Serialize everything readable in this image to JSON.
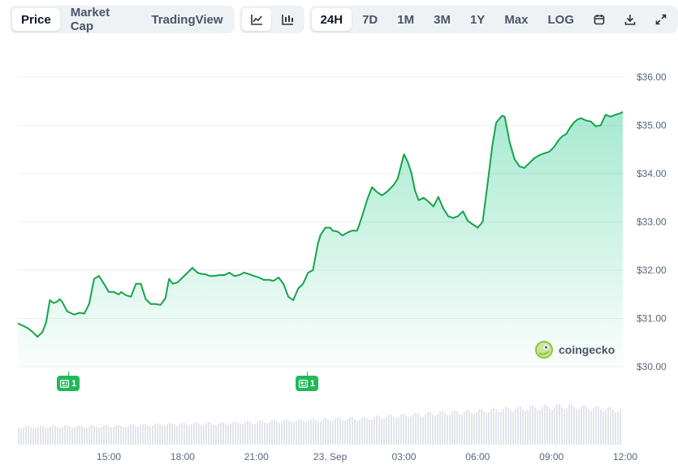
{
  "toolbar": {
    "chart_tabs": [
      {
        "label": "Price",
        "active": true
      },
      {
        "label": "Market Cap",
        "active": false
      },
      {
        "label": "TradingView",
        "active": false
      }
    ],
    "chart_style_icons": [
      {
        "icon": "line-chart-icon",
        "active": true
      },
      {
        "icon": "candlestick-icon",
        "active": false
      }
    ],
    "ranges": [
      {
        "label": "24H",
        "active": true
      },
      {
        "label": "7D",
        "active": false
      },
      {
        "label": "1M",
        "active": false
      },
      {
        "label": "3M",
        "active": false
      },
      {
        "label": "1Y",
        "active": false
      },
      {
        "label": "Max",
        "active": false
      },
      {
        "label": "LOG",
        "active": false
      }
    ],
    "action_icons": [
      "calendar-icon",
      "download-icon",
      "expand-icon"
    ]
  },
  "brand": {
    "name": "coingecko",
    "icon": "gecko-logo-icon"
  },
  "events": [
    {
      "count": "1",
      "x_hour": 13.35,
      "icon": "news-icon"
    },
    {
      "count": "1",
      "x_hour": 23.05,
      "icon": "news-icon"
    }
  ],
  "colors": {
    "line": "#16a34a",
    "area": "#16c784",
    "volume": "#e2e5ea",
    "badge": "#22b859"
  },
  "chart_data": {
    "type": "area",
    "title": "",
    "xlabel": "",
    "ylabel": "",
    "x_range_hours": [
      11.3,
      35.9
    ],
    "ylim": [
      29.9,
      36.2
    ],
    "y_ticks": [
      30,
      31,
      32,
      33,
      34,
      35,
      36
    ],
    "y_tick_labels": [
      "$30.00",
      "$31.00",
      "$32.00",
      "$33.00",
      "$34.00",
      "$35.00",
      "$36.00"
    ],
    "x_ticks": [
      {
        "hour": 15,
        "label": "15:00"
      },
      {
        "hour": 18,
        "label": "18:00"
      },
      {
        "hour": 21,
        "label": "21:00"
      },
      {
        "hour": 24,
        "label": "23. Sep"
      },
      {
        "hour": 27,
        "label": "03:00"
      },
      {
        "hour": 30,
        "label": "06:00"
      },
      {
        "hour": 33,
        "label": "09:00"
      },
      {
        "hour": 36,
        "label": "12:00"
      }
    ],
    "grid": true,
    "series": [
      {
        "x": [
          11.3,
          11.5,
          11.7,
          11.9,
          12.1,
          12.3,
          12.45,
          12.6,
          12.75,
          12.9,
          13.0,
          13.1,
          13.3,
          13.5,
          13.6,
          13.8,
          14.0,
          14.2,
          14.4,
          14.6,
          14.8,
          15.0,
          15.2,
          15.4,
          15.5,
          15.7,
          15.9,
          16.1,
          16.3,
          16.5,
          16.7,
          16.9,
          17.1,
          17.3,
          17.45,
          17.6,
          17.8,
          18.0,
          18.2,
          18.4,
          18.6,
          18.8,
          18.9,
          19.1,
          19.3,
          19.5,
          19.7,
          19.9,
          20.1,
          20.3,
          20.5,
          20.7,
          20.9,
          21.1,
          21.3,
          21.5,
          21.7,
          21.9,
          22.1,
          22.3,
          22.5,
          22.7,
          22.9,
          23.1,
          23.3,
          23.5,
          23.6,
          23.8,
          23.9,
          24.0,
          24.1,
          24.3,
          24.5,
          24.7,
          24.9,
          25.1,
          25.3,
          25.5,
          25.7,
          25.9,
          26.1,
          26.3,
          26.5,
          26.6,
          26.75,
          26.9,
          27.0,
          27.15,
          27.3,
          27.45,
          27.6,
          27.8,
          28.0,
          28.2,
          28.4,
          28.6,
          28.8,
          29.0,
          29.2,
          29.4,
          29.6,
          29.8,
          30.0,
          30.2,
          30.4,
          30.6,
          30.75,
          30.9,
          31.0,
          31.1,
          31.3,
          31.5,
          31.7,
          31.9,
          32.1,
          32.3,
          32.5,
          32.7,
          32.9,
          33.1,
          33.3,
          33.45,
          33.6,
          33.75,
          33.9,
          34.05,
          34.2,
          34.4,
          34.6,
          34.8,
          35.0,
          35.2,
          35.4,
          35.6,
          35.8,
          35.9
        ],
        "y": [
          30.9,
          30.85,
          30.8,
          30.72,
          30.62,
          30.72,
          30.92,
          31.38,
          31.32,
          31.35,
          31.4,
          31.35,
          31.15,
          31.1,
          31.08,
          31.12,
          31.1,
          31.3,
          31.82,
          31.88,
          31.72,
          31.55,
          31.55,
          31.5,
          31.55,
          31.48,
          31.45,
          31.72,
          31.72,
          31.4,
          31.3,
          31.3,
          31.28,
          31.42,
          31.82,
          31.72,
          31.75,
          31.85,
          31.95,
          32.05,
          31.95,
          31.92,
          31.92,
          31.88,
          31.88,
          31.9,
          31.9,
          31.95,
          31.88,
          31.9,
          31.95,
          31.92,
          31.88,
          31.85,
          31.8,
          31.8,
          31.78,
          31.85,
          31.72,
          31.45,
          31.38,
          31.62,
          31.72,
          31.95,
          32.0,
          32.55,
          32.72,
          32.88,
          32.88,
          32.88,
          32.82,
          32.8,
          32.72,
          32.78,
          32.82,
          32.82,
          33.12,
          33.45,
          33.72,
          33.62,
          33.55,
          33.62,
          33.72,
          33.78,
          33.9,
          34.2,
          34.4,
          34.25,
          34.02,
          33.65,
          33.45,
          33.5,
          33.42,
          33.32,
          33.52,
          33.28,
          33.12,
          33.08,
          33.12,
          33.22,
          33.02,
          32.95,
          32.88,
          33.0,
          33.78,
          34.6,
          35.05,
          35.15,
          35.2,
          35.18,
          34.65,
          34.3,
          34.15,
          34.12,
          34.22,
          34.32,
          34.38,
          34.42,
          34.45,
          34.55,
          34.7,
          34.78,
          34.82,
          34.95,
          35.05,
          35.12,
          35.15,
          35.1,
          35.08,
          34.98,
          35.0,
          35.22,
          35.18,
          35.22,
          35.25,
          35.28
        ]
      }
    ],
    "volume": {
      "x": [
        11.3,
        12.3,
        13.3,
        14.3,
        15.3,
        16.3,
        17.3,
        18.3,
        19.3,
        20.3,
        21.3,
        22.3,
        23.3,
        24.3,
        25.3,
        26.3,
        27.3,
        28.3,
        29.3,
        30.3,
        31.3,
        32.3,
        33.3,
        34.3,
        35.3,
        35.9
      ],
      "y": [
        0.42,
        0.42,
        0.43,
        0.43,
        0.44,
        0.46,
        0.48,
        0.49,
        0.5,
        0.52,
        0.54,
        0.56,
        0.58,
        0.6,
        0.62,
        0.66,
        0.7,
        0.74,
        0.77,
        0.8,
        0.85,
        0.87,
        0.9,
        0.88,
        0.84,
        0.8
      ]
    }
  }
}
